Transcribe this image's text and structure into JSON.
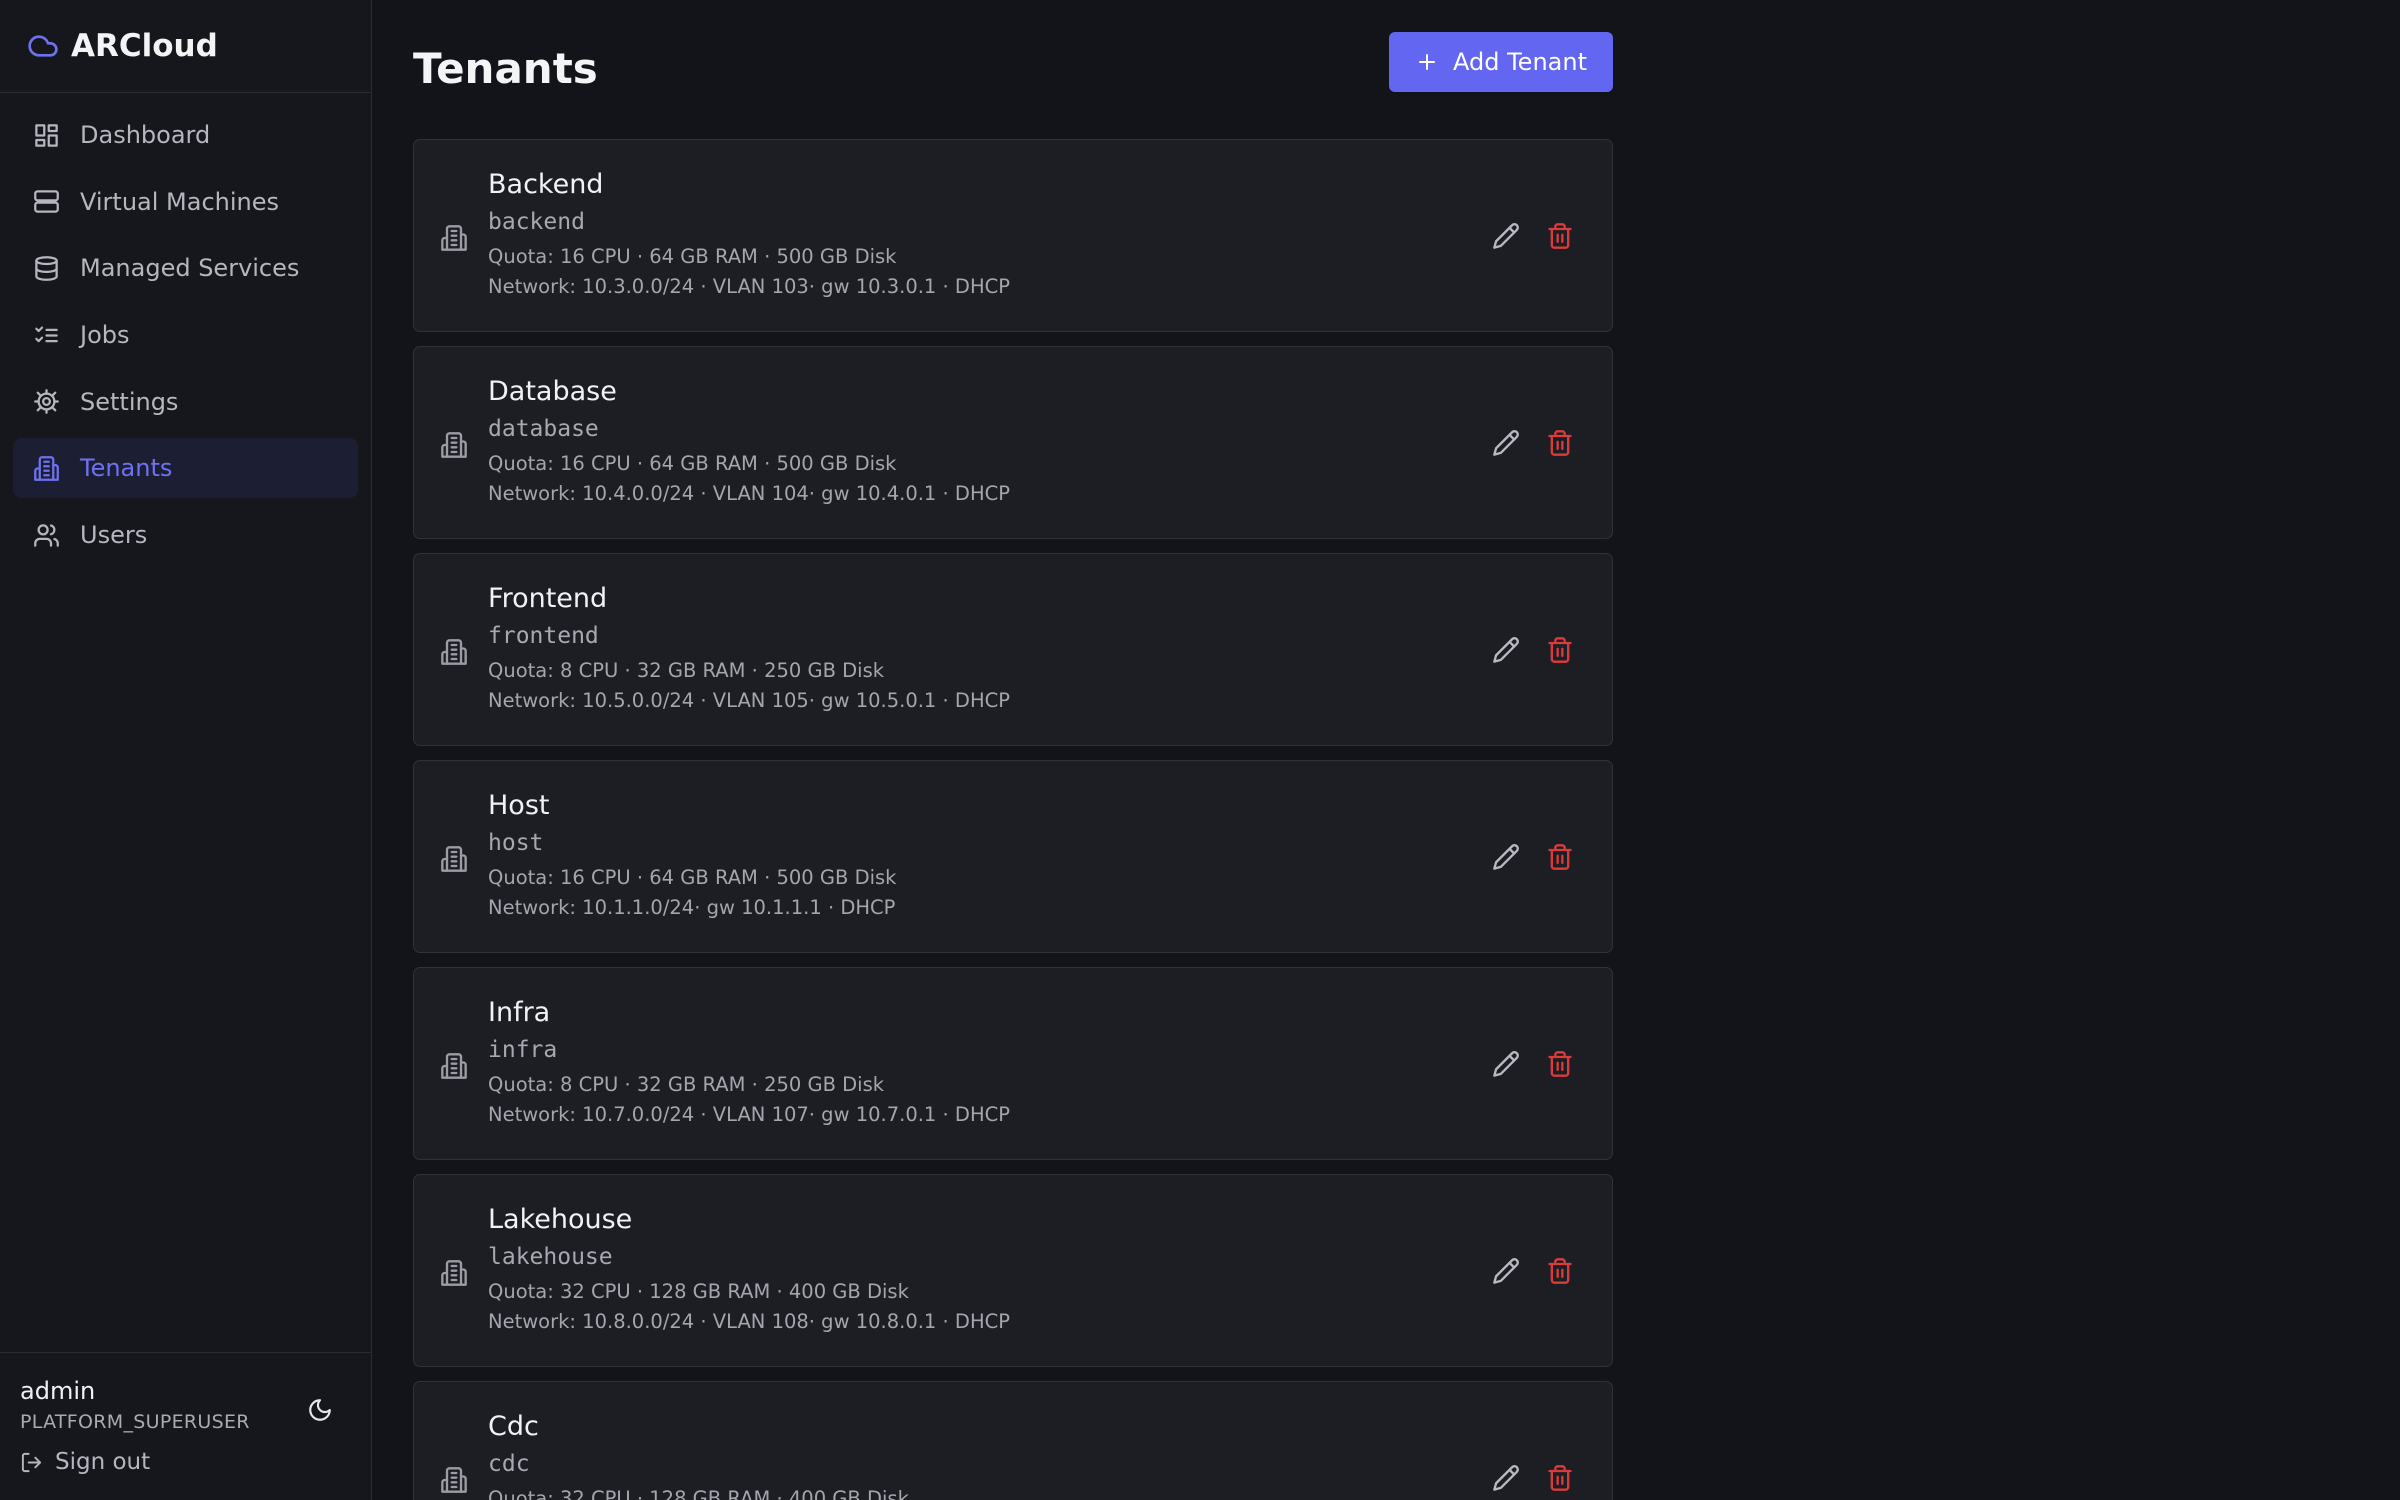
{
  "app": {
    "name": "ARCloud",
    "logo_icon": "cloud-icon",
    "accent": "#6266f0",
    "danger": "#dc3b3b"
  },
  "sidebar": {
    "items": [
      {
        "label": "Dashboard",
        "icon": "dashboard-icon",
        "active": false
      },
      {
        "label": "Virtual Machines",
        "icon": "server-icon",
        "active": false
      },
      {
        "label": "Managed Services",
        "icon": "database-icon",
        "active": false
      },
      {
        "label": "Jobs",
        "icon": "list-checks-icon",
        "active": false
      },
      {
        "label": "Settings",
        "icon": "gear-icon",
        "active": false
      },
      {
        "label": "Tenants",
        "icon": "building-icon",
        "active": true
      },
      {
        "label": "Users",
        "icon": "users-icon",
        "active": false
      }
    ],
    "footer": {
      "username": "admin",
      "role": "PLATFORM_SUPERUSER",
      "theme_icon": "moon-icon",
      "signout_label": "Sign out"
    }
  },
  "header": {
    "title": "Tenants",
    "add_button_label": "Add Tenant"
  },
  "tenants": [
    {
      "name": "Backend",
      "slug": "backend",
      "quota": "Quota: 16 CPU · 64 GB RAM · 500 GB Disk",
      "network": "Network: 10.3.0.0/24 · VLAN 103· gw 10.3.0.1 · DHCP"
    },
    {
      "name": "Database",
      "slug": "database",
      "quota": "Quota: 16 CPU · 64 GB RAM · 500 GB Disk",
      "network": "Network: 10.4.0.0/24 · VLAN 104· gw 10.4.0.1 · DHCP"
    },
    {
      "name": "Frontend",
      "slug": "frontend",
      "quota": "Quota: 8 CPU · 32 GB RAM · 250 GB Disk",
      "network": "Network: 10.5.0.0/24 · VLAN 105· gw 10.5.0.1 · DHCP"
    },
    {
      "name": "Host",
      "slug": "host",
      "quota": "Quota: 16 CPU · 64 GB RAM · 500 GB Disk",
      "network": "Network: 10.1.1.0/24· gw 10.1.1.1 · DHCP"
    },
    {
      "name": "Infra",
      "slug": "infra",
      "quota": "Quota: 8 CPU · 32 GB RAM · 250 GB Disk",
      "network": "Network: 10.7.0.0/24 · VLAN 107· gw 10.7.0.1 · DHCP"
    },
    {
      "name": "Lakehouse",
      "slug": "lakehouse",
      "quota": "Quota: 32 CPU · 128 GB RAM · 400 GB Disk",
      "network": "Network: 10.8.0.0/24 · VLAN 108· gw 10.8.0.1 · DHCP"
    },
    {
      "name": "Cdc",
      "slug": "cdc",
      "quota": "Quota: 32 CPU · 128 GB RAM · 400 GB Disk",
      "network": ""
    }
  ]
}
